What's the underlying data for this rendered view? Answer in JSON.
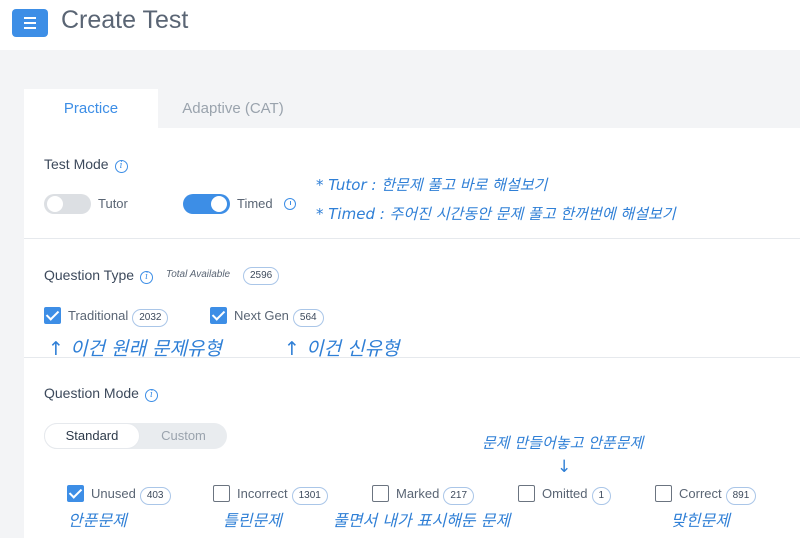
{
  "header": {
    "title": "Create Test"
  },
  "tabs": [
    {
      "label": "Practice"
    },
    {
      "label": "Adaptive (CAT)"
    }
  ],
  "test_mode": {
    "title": "Test Mode",
    "tutor_label": "Tutor",
    "tutor_on": false,
    "timed_label": "Timed",
    "timed_on": true
  },
  "question_type": {
    "title": "Question Type",
    "total_available_label": "Total Available",
    "total_available": "2596",
    "traditional_label": "Traditional",
    "traditional_count": "2032",
    "nextgen_label": "Next Gen",
    "nextgen_count": "564"
  },
  "question_mode": {
    "title": "Question Mode",
    "standard_label": "Standard",
    "custom_label": "Custom",
    "options": [
      {
        "label": "Unused",
        "count": "403",
        "checked": true
      },
      {
        "label": "Incorrect",
        "count": "1301",
        "checked": false
      },
      {
        "label": "Marked",
        "count": "217",
        "checked": false
      },
      {
        "label": "Omitted",
        "count": "1",
        "checked": false
      },
      {
        "label": "Correct",
        "count": "891",
        "checked": false
      }
    ]
  },
  "annotations": {
    "tutor_note": "* Tutor : 한문제 풀고 바로 해설보기",
    "timed_note": "* Timed : 주어진 시간동안 문제 풀고 한꺼번에 해설보기",
    "traditional_note": "↑ 이건 원래 문제유형",
    "nextgen_note": "↑ 이건 신유형",
    "omitted_note": "문제 만들어놓고 안푼문제",
    "omitted_arrow": "↓",
    "unused_note": "안푼문제",
    "incorrect_note": "틀린문제",
    "marked_note": "풀면서 내가 표시해둔 문제",
    "correct_note": "맞힌문제"
  },
  "colors": {
    "accent": "#3d8ee6",
    "annotation": "#2f7fd6"
  }
}
